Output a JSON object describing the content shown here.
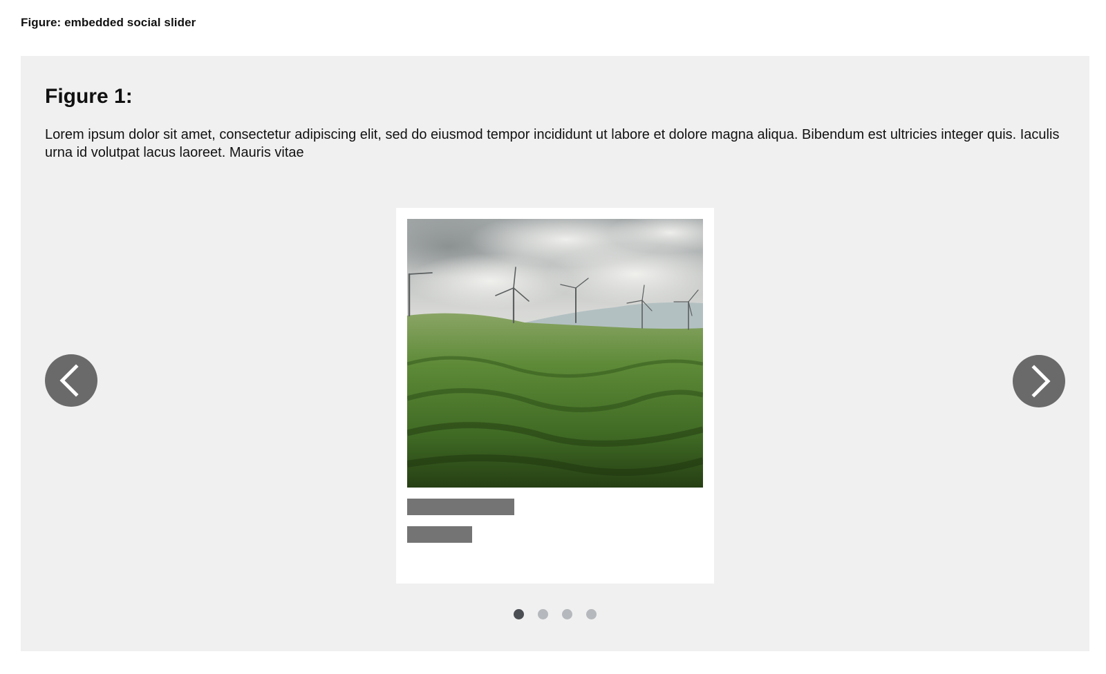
{
  "page": {
    "caption": "Figure: embedded social slider"
  },
  "figure": {
    "title": "Figure 1:",
    "body": "Lorem ipsum dolor sit amet, consectetur adipiscing elit, sed do eiusmod tempor incididunt ut labore et dolore magna aliqua. Bibendum est ultricies integer quis. Iaculis urna id volutpat lacus laoreet. Mauris vitae"
  },
  "slider": {
    "slide_count": 4,
    "active_index": 0,
    "prev_icon": "chevron-left-icon",
    "next_icon": "chevron-right-icon",
    "slide": {
      "image_subject": "green rolling hills with wind turbines under a cloudy sky"
    }
  },
  "colors": {
    "panel_bg": "#f0f0f0",
    "card_bg": "#ffffff",
    "placeholder_bar": "#747474",
    "arrow_bg": "#6a6a6a",
    "dot_active": "#4b4e53",
    "dot_inactive": "#b5b8bc"
  }
}
